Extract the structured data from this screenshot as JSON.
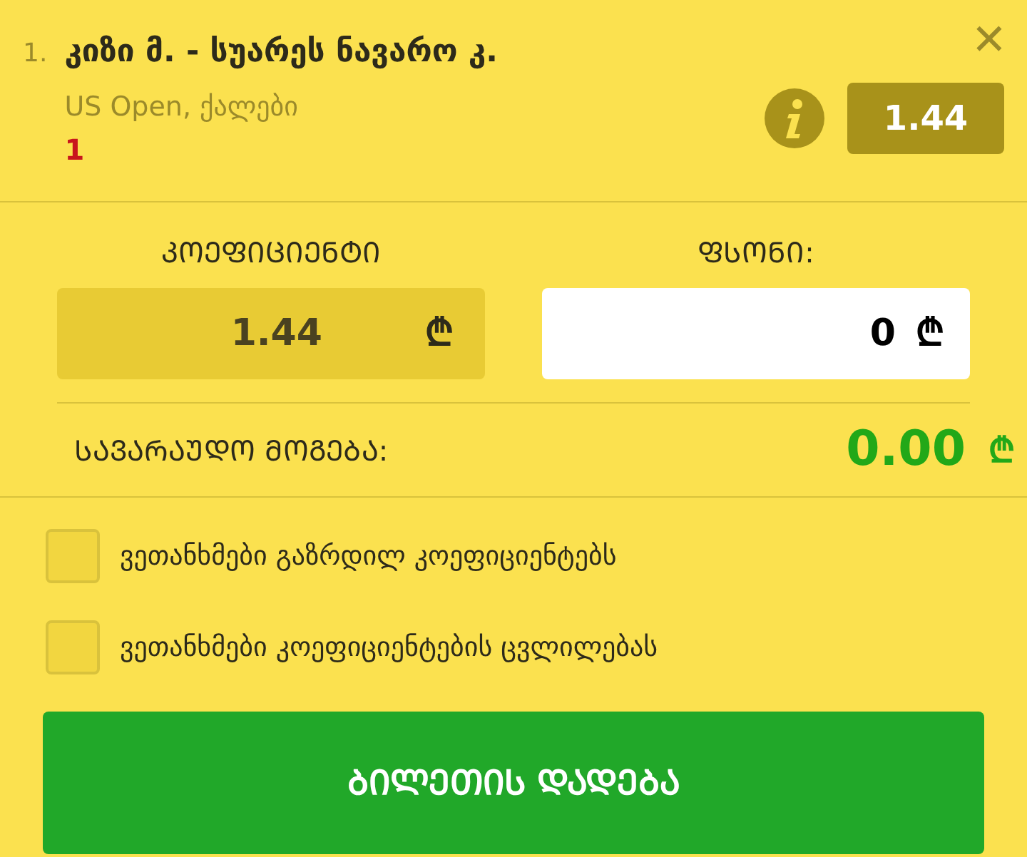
{
  "selection": {
    "index": "1.",
    "title": "კიზი მ. - სუარეს ნავარო კ.",
    "subtitle": "US Open, ქალები",
    "pick": "1",
    "close": "✕",
    "odds": "1.44"
  },
  "odds_field": {
    "label": "ᲙᲝᲔᲤᲘᲪᲘᲔᲜᲢᲘ",
    "value": "1.44",
    "currency": "₾"
  },
  "stake_field": {
    "label": "ᲤᲡᲝᲜᲘ:",
    "value": "0",
    "currency": "₾"
  },
  "potential_win": {
    "label": "ᲡᲐᲕᲐᲠᲐᲣᲓᲝ ᲛᲝᲒᲔᲑᲐ:",
    "value": "0.00",
    "currency": "₾"
  },
  "checkboxes": [
    {
      "label": "ვეთანხმები გაზრდილ კოეფიციენტებს",
      "checked": false
    },
    {
      "label": "ვეთანხმები კოეფიციენტების ცვლილებას",
      "checked": false
    }
  ],
  "submit": "ᲑᲘᲚᲔᲗᲘᲡ ᲓᲐᲓᲔᲑᲐ"
}
